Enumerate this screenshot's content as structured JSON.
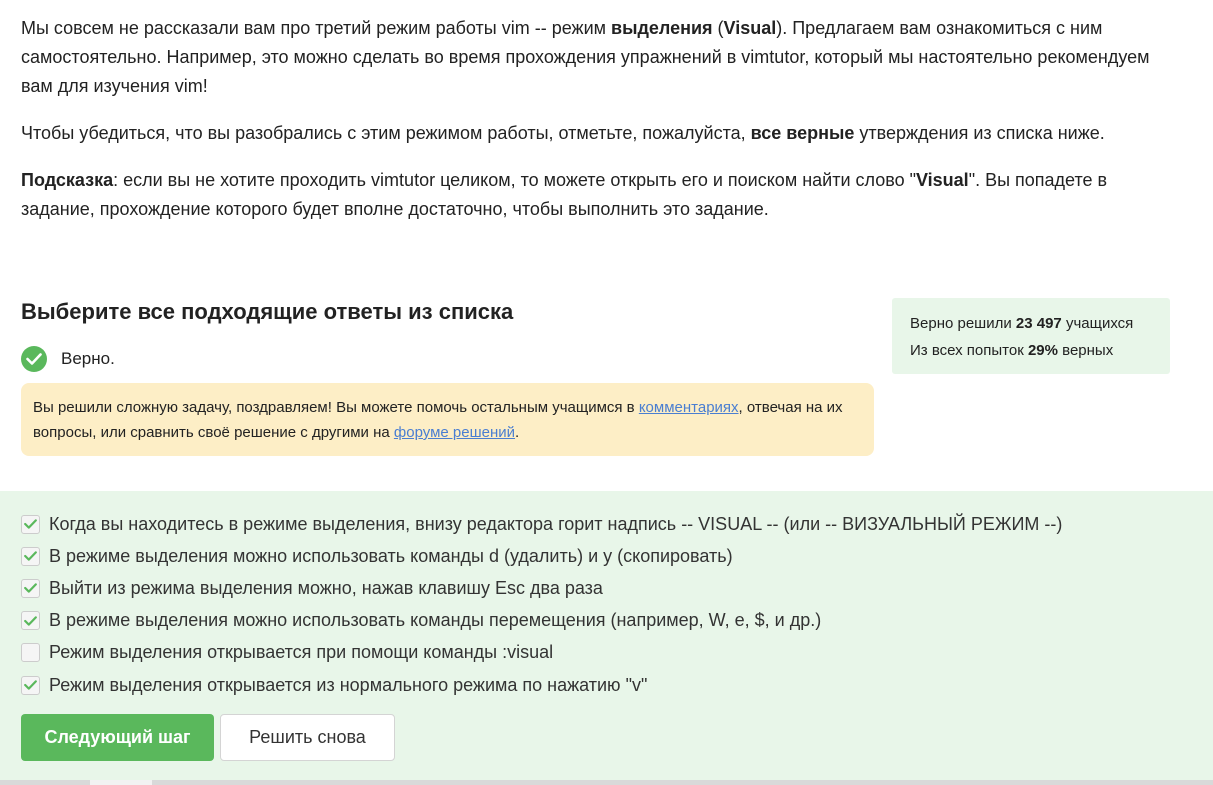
{
  "theory": {
    "p1_a": "Мы совсем не рассказали вам про третий режим работы vim -- режим ",
    "p1_b": "выделения",
    "p1_c": " (",
    "p1_d": "Visual",
    "p1_e": "). Предлагаем вам ознакомиться с ним самостоятельно. Например, это можно сделать во время прохождения упражнений в vimtutor, который мы настоятельно рекомендуем вам для изучения vim!",
    "p2_a": "Чтобы убедиться, что вы разобрались с этим режимом работы, отметьте, пожалуйста, ",
    "p2_b": "все верные",
    "p2_c": " утверждения из списка ниже.",
    "p3_a": "Подсказка",
    "p3_b": ": если вы не хотите проходить vimtutor целиком, то можете открыть его и поиском найти слово \"",
    "p3_c": "Visual",
    "p3_d": "\". Вы попадете в задание, прохождение которого будет вполне достаточно, чтобы выполнить это задание."
  },
  "question": {
    "title": "Выберите все подходящие ответы из списка"
  },
  "stats": {
    "solved_prefix": "Верно решили ",
    "solved_count": "23 497",
    "solved_suffix": " учащихся",
    "attempts_prefix": "Из всех попыток ",
    "attempts_percent": "29%",
    "attempts_suffix": " верных"
  },
  "verdict": {
    "label": "Верно."
  },
  "hint": {
    "text_a": "Вы решили сложную задачу, поздравляем! Вы можете помочь остальным учащимся в ",
    "link_comments": "комментариях",
    "text_b": ", отвечая на их вопросы, или сравнить своё решение с другими на ",
    "link_forum": "форуме решений",
    "text_c": "."
  },
  "options": [
    {
      "text": "Когда вы находитесь в режиме выделения, внизу редактора горит надпись -- VISUAL -- (или -- ВИЗУАЛЬНЫЙ РЕЖИМ --)",
      "checked": true
    },
    {
      "text": "В режиме выделения можно использовать команды d (удалить) и y (скопировать)",
      "checked": true
    },
    {
      "text": "Выйти из режима выделения можно, нажав клавишу Esc два раза",
      "checked": true
    },
    {
      "text": "В режиме выделения можно использовать команды перемещения (например, W, e, $, и др.)",
      "checked": true
    },
    {
      "text": "Режим выделения открывается при помощи команды :visual",
      "checked": false
    },
    {
      "text": "Режим выделения открывается из нормального режима по нажатию \"v\"",
      "checked": true
    }
  ],
  "buttons": {
    "next_step": "Следующий шаг",
    "retry": "Решить снова"
  },
  "colors": {
    "accent_green": "#5ab85c",
    "answers_bg": "#e8f6e9",
    "hint_bg": "#fdeec6",
    "link": "#4a7ed1"
  },
  "icons": {
    "verdict": "check-circle-icon",
    "checkbox_checked": "checkmark-icon"
  }
}
